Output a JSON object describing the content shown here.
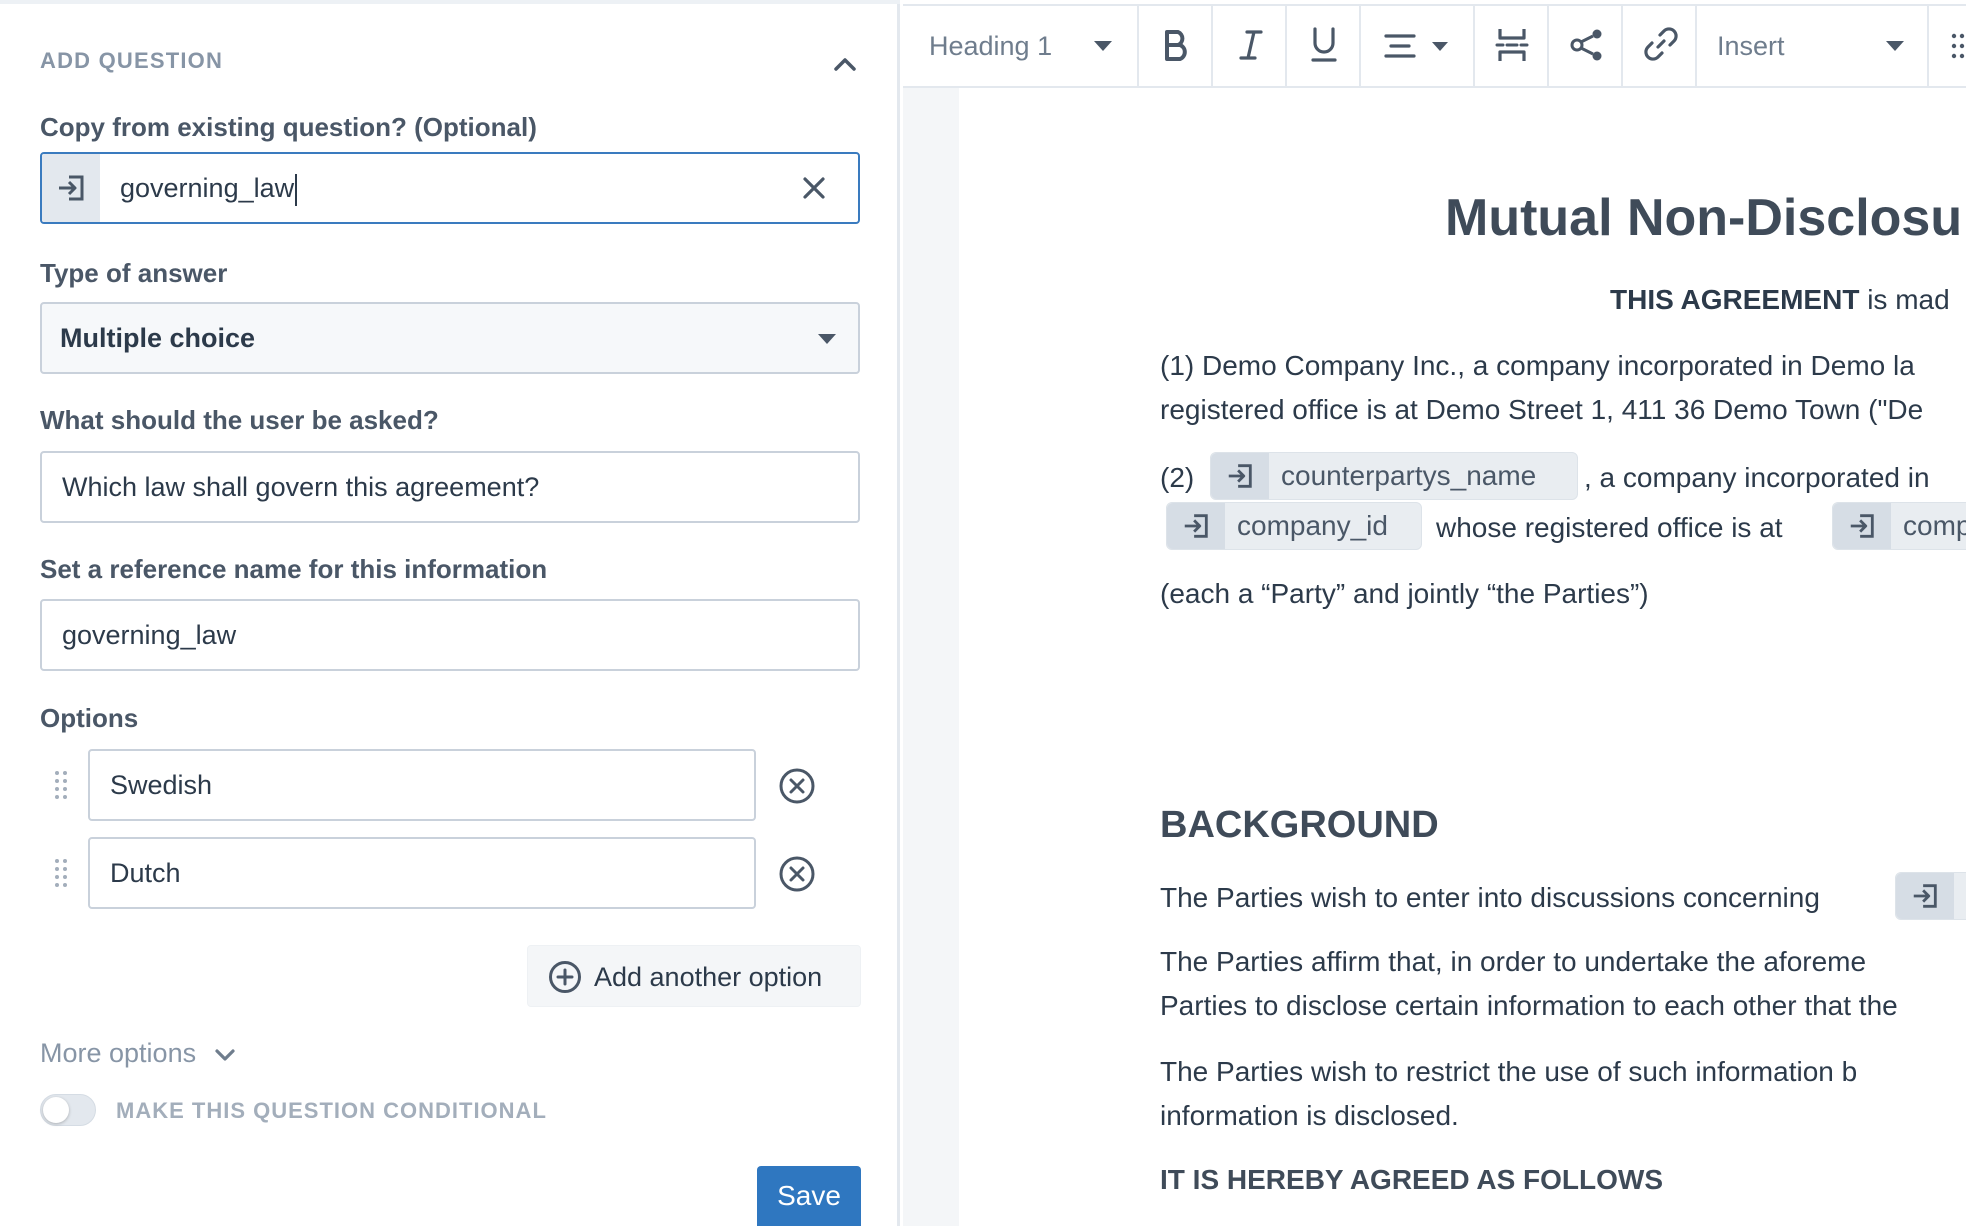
{
  "panel": {
    "section_title": "ADD QUESTION",
    "copy_label": "Copy from existing question? (Optional)",
    "copy_value": "governing_law",
    "type_label": "Type of answer",
    "type_value": "Multiple choice",
    "ask_label": "What should the user be asked?",
    "ask_value": "Which law shall govern this agreement?",
    "ref_label": "Set a reference name for this information",
    "ref_value": "governing_law",
    "options_label": "Options",
    "options": [
      "Swedish",
      "Dutch"
    ],
    "add_option_label": "Add another option",
    "more_options_label": "More options",
    "conditional_label": "MAKE THIS QUESTION CONDITIONAL",
    "conditional_on": false,
    "save_label": "Save"
  },
  "toolbar": {
    "style_value": "Heading 1",
    "insert_label": "Insert",
    "icons": [
      "bold-icon",
      "italic-icon",
      "underline-icon",
      "align-icon",
      "page-break-icon",
      "share-nodes-icon",
      "link-icon",
      "more-icon"
    ]
  },
  "document": {
    "title": "Mutual Non-Disclosu",
    "intro_bold": "THIS AGREEMENT",
    "intro_rest": " is mad",
    "party1_line1": "(1) Demo Company Inc., a company incorporated in Demo la",
    "party1_line2": "registered office is at Demo Street 1, 411 36 Demo Town (\"De",
    "party2_prefix": "(2)",
    "chip_counterparty": "counterpartys_name",
    "party2_after_chip": ", a company incorporated in",
    "chip_company_id": "company_id",
    "party2_line2_mid": "whose registered office is at",
    "chip_company_cut": "comp",
    "parties_line": "(each a “Party” and jointly “the Parties”)",
    "background_heading": "BACKGROUND",
    "bg_line1": "The Parties wish to enter into discussions concerning",
    "bg_line2a": "The Parties affirm that, in order to undertake the aforeme",
    "bg_line2b": "Parties to disclose certain information to each other that the",
    "bg_line3a": "The Parties wish to restrict the use of such information b",
    "bg_line3b": "information is disclosed.",
    "agreed_heading": "IT IS HEREBY AGREED AS FOLLOWS"
  },
  "colors": {
    "accent": "#2f77c0",
    "focus_border": "#3a7bbf",
    "label": "#4a5767",
    "muted": "#8795a6"
  }
}
